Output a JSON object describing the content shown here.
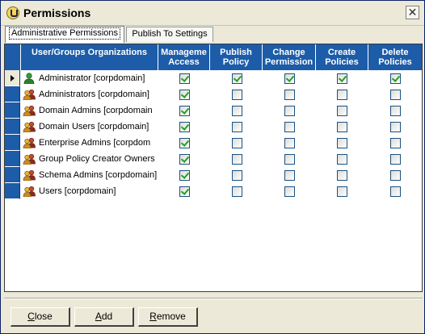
{
  "window": {
    "title": "Permissions",
    "close_glyph": "✕"
  },
  "tabs": [
    {
      "label": "Administrative Permissions",
      "active": true
    },
    {
      "label": "Publish To Settings",
      "active": false
    }
  ],
  "table": {
    "headers": {
      "user": "User/Groups Organizations",
      "cols": [
        "Manageme Access",
        "Publish Policy",
        "Change Permission",
        "Create Policies",
        "Delete Policies"
      ]
    },
    "rows": [
      {
        "name": "Administrator [corpdomain]",
        "icon": "single-user-icon",
        "checks": [
          true,
          true,
          true,
          true,
          true
        ],
        "current": true
      },
      {
        "name": "Administrators [corpdomain]",
        "icon": "group-icon",
        "checks": [
          true,
          false,
          false,
          false,
          false
        ],
        "current": false
      },
      {
        "name": "Domain Admins [corpdomain",
        "icon": "group-icon",
        "checks": [
          true,
          false,
          false,
          false,
          false
        ],
        "current": false
      },
      {
        "name": "Domain Users [corpdomain]",
        "icon": "group-icon",
        "checks": [
          true,
          false,
          false,
          false,
          false
        ],
        "current": false
      },
      {
        "name": "Enterprise Admins [corpdom",
        "icon": "group-icon",
        "checks": [
          true,
          false,
          false,
          false,
          false
        ],
        "current": false
      },
      {
        "name": "Group Policy Creator Owners",
        "icon": "group-icon",
        "checks": [
          true,
          false,
          false,
          false,
          false
        ],
        "current": false
      },
      {
        "name": "Schema Admins [corpdomain]",
        "icon": "group-icon",
        "checks": [
          true,
          false,
          false,
          false,
          false
        ],
        "current": false
      },
      {
        "name": "Users [corpdomain]",
        "icon": "group-icon",
        "checks": [
          true,
          false,
          false,
          false,
          false
        ],
        "current": false
      }
    ]
  },
  "buttons": {
    "close": "Close",
    "add": "Add",
    "remove": "Remove"
  },
  "colors": {
    "header": "#1c5ca8",
    "check": "#21a121",
    "face": "#ece9d8"
  }
}
